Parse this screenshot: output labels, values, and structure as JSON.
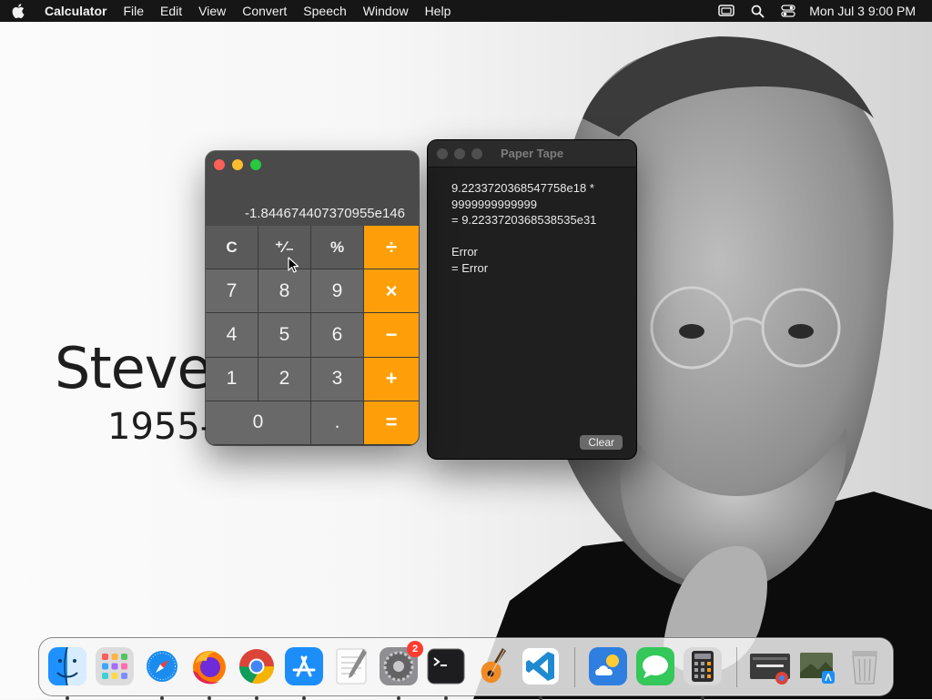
{
  "menubar": {
    "app_name": "Calculator",
    "items": [
      "File",
      "Edit",
      "View",
      "Convert",
      "Speech",
      "Window",
      "Help"
    ],
    "clock": "Mon Jul 3  9:00 PM"
  },
  "wallpaper": {
    "name_text": "Steve",
    "years_text": "1955-"
  },
  "calculator": {
    "display": "-1.844674407370955e146",
    "keys": {
      "clear": "C",
      "sign": "⁺∕₋",
      "percent": "%",
      "divide": "÷",
      "seven": "7",
      "eight": "8",
      "nine": "9",
      "multiply": "×",
      "four": "4",
      "five": "5",
      "six": "6",
      "minus": "−",
      "one": "1",
      "two": "2",
      "three": "3",
      "plus": "+",
      "zero": "0",
      "decimal": ".",
      "equals": "="
    },
    "colors": {
      "operator": "#fe9f0a",
      "digit": "#696969",
      "function": "#5a5a5a"
    }
  },
  "paper_tape": {
    "title": "Paper Tape",
    "lines": [
      "9.2233720368547758e18 *",
      "9999999999999",
      "= 9.2233720368538535e31",
      "",
      "Error",
      "= Error"
    ],
    "clear_label": "Clear"
  },
  "dock": {
    "apps": [
      {
        "name": "Finder",
        "icon": "finder-icon",
        "running": true
      },
      {
        "name": "Launchpad",
        "icon": "launchpad-icon",
        "running": false
      },
      {
        "name": "Safari",
        "icon": "safari-icon",
        "running": true
      },
      {
        "name": "Firefox",
        "icon": "firefox-icon",
        "running": true
      },
      {
        "name": "Google Chrome",
        "icon": "chrome-icon",
        "running": true
      },
      {
        "name": "App Store",
        "icon": "app-store-icon",
        "running": true
      },
      {
        "name": "TextEdit",
        "icon": "textedit-icon",
        "running": false
      },
      {
        "name": "System Settings",
        "icon": "system-settings-icon",
        "running": true,
        "badge": "2"
      },
      {
        "name": "Terminal",
        "icon": "terminal-icon",
        "running": true
      },
      {
        "name": "GarageBand",
        "icon": "garageband-icon",
        "running": false
      },
      {
        "name": "Visual Studio Code",
        "icon": "vscode-icon",
        "running": true
      },
      {
        "name": "Weather",
        "icon": "weather-icon",
        "running": false
      },
      {
        "name": "Messages",
        "icon": "messages-icon",
        "running": false
      },
      {
        "name": "Calculator",
        "icon": "calculator-icon",
        "running": true
      },
      {
        "name": "Chrome Window",
        "icon": "chrome-window-thumbnail-icon",
        "running": false
      },
      {
        "name": "Preview",
        "icon": "preview-thumbnail-icon",
        "running": false
      },
      {
        "name": "Trash",
        "icon": "trash-icon",
        "running": false
      }
    ]
  }
}
